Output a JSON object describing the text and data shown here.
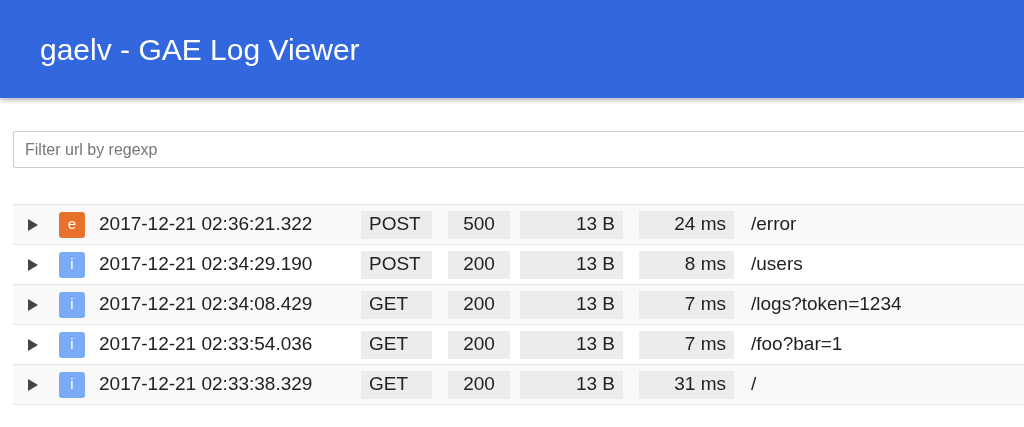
{
  "header": {
    "title": "gaelv - GAE Log Viewer"
  },
  "filter": {
    "placeholder": "Filter url by regexp"
  },
  "rows": [
    {
      "expanded": false,
      "badge": "e",
      "color": "#e8722c",
      "time": "2017-12-21 02:36:21.322",
      "method": "POST",
      "status": "500",
      "size": "13 B",
      "duration": "24 ms",
      "path": "/error"
    },
    {
      "expanded": false,
      "badge": "i",
      "color": "#7aabf6",
      "time": "2017-12-21 02:34:29.190",
      "method": "POST",
      "status": "200",
      "size": "13 B",
      "duration": "8 ms",
      "path": "/users"
    },
    {
      "expanded": false,
      "badge": "i",
      "color": "#7aabf6",
      "time": "2017-12-21 02:34:08.429",
      "method": "GET",
      "status": "200",
      "size": "13 B",
      "duration": "7 ms",
      "path": "/logs?token=1234"
    },
    {
      "expanded": false,
      "badge": "i",
      "color": "#7aabf6",
      "time": "2017-12-21 02:33:54.036",
      "method": "GET",
      "status": "200",
      "size": "13 B",
      "duration": "7 ms",
      "path": "/foo?bar=1"
    },
    {
      "expanded": false,
      "badge": "i",
      "color": "#7aabf6",
      "time": "2017-12-21 02:33:38.329",
      "method": "GET",
      "status": "200",
      "size": "13 B",
      "duration": "31 ms",
      "path": "/"
    }
  ]
}
